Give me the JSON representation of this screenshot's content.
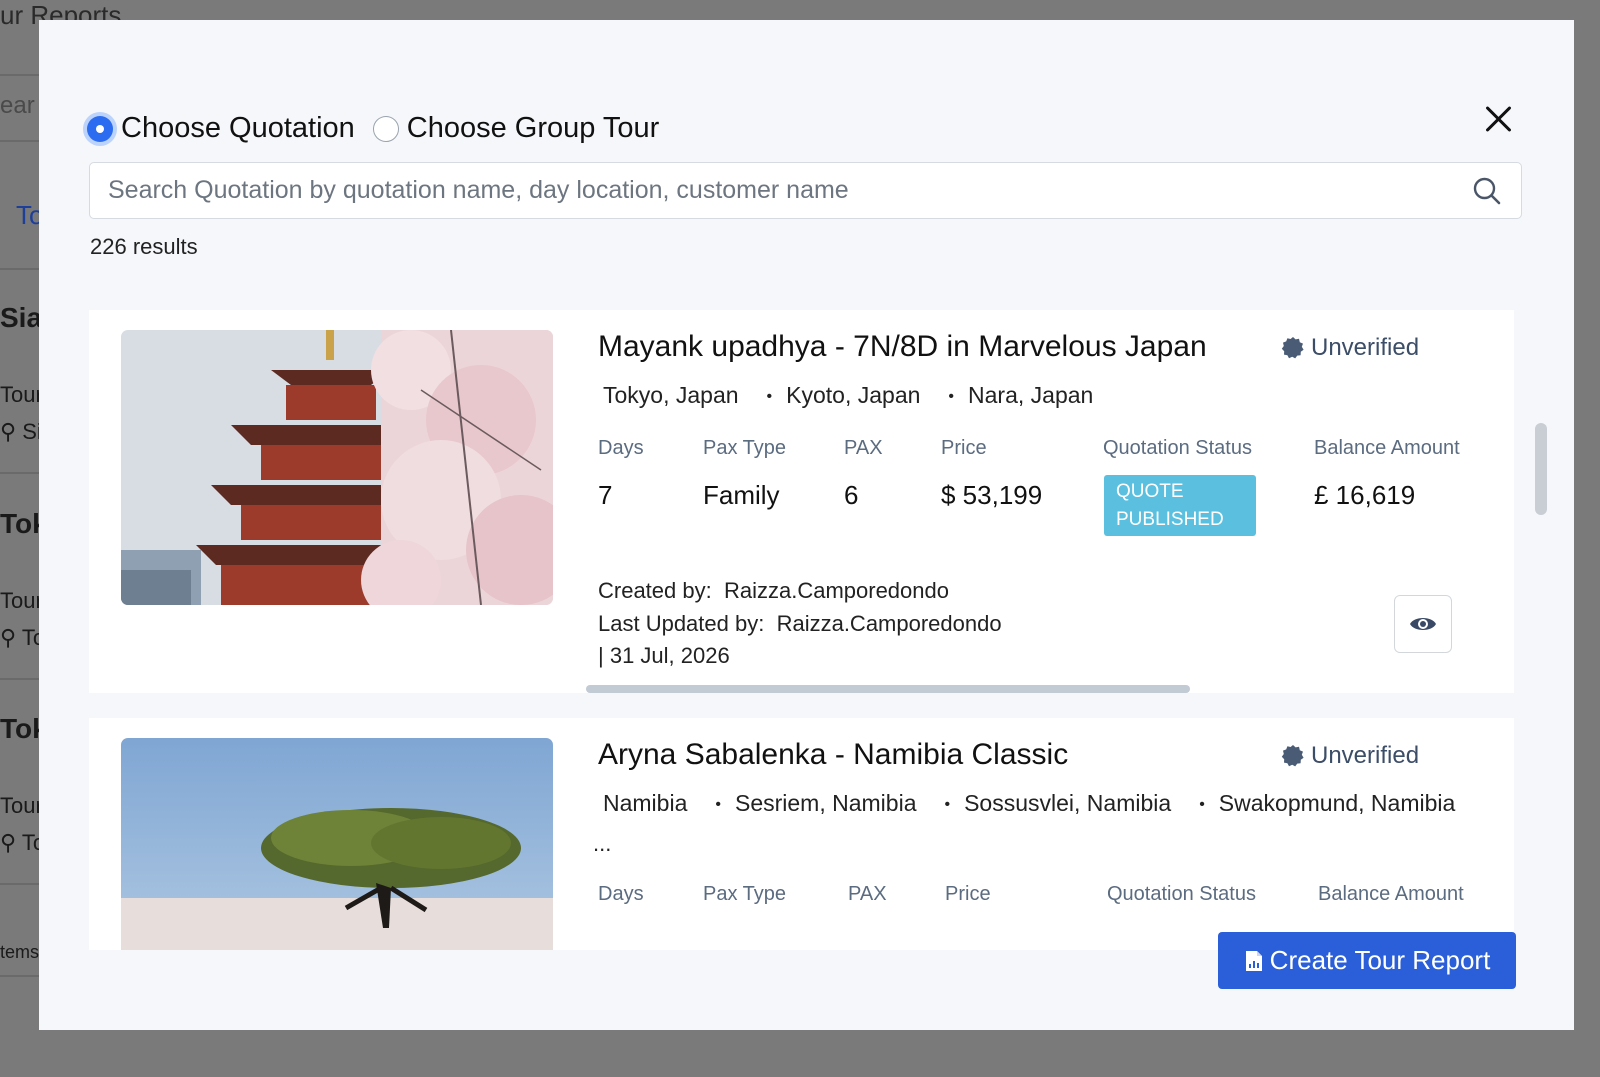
{
  "background": {
    "page_title": "ur Reports",
    "search_fragment": "ear",
    "tab_fragment": "To",
    "cards": [
      {
        "title": "Siar",
        "sub": "Tour",
        "loc": "Si"
      },
      {
        "title": "Tok",
        "sub": "Tour",
        "loc": "To"
      },
      {
        "title": "Tok",
        "sub": "Tour",
        "loc": "To"
      }
    ],
    "items_fragment": "tems"
  },
  "modal": {
    "radio_options": [
      {
        "label": "Choose Quotation",
        "checked": true
      },
      {
        "label": "Choose Group Tour",
        "checked": false
      }
    ],
    "search": {
      "placeholder": "Search Quotation by quotation name, day location, customer name"
    },
    "results_count": "226 results",
    "field_labels": {
      "days": "Days",
      "pax_type": "Pax Type",
      "pax": "PAX",
      "price": "Price",
      "status": "Quotation Status",
      "balance": "Balance Amount"
    },
    "quotations": [
      {
        "title": "Mayank upadhya - 7N/8D in Marvelous Japan",
        "badge": "Unverified",
        "locations": [
          "Tokyo, Japan",
          "Kyoto, Japan",
          "Nara, Japan"
        ],
        "days": "7",
        "pax_type": "Family",
        "pax": "6",
        "price": "$ 53,199",
        "status": "QUOTE PUBLISHED",
        "balance": "£ 16,619",
        "created_by_label": "Created by:",
        "created_by": "Raizza.Camporedondo",
        "updated_by_label": "Last Updated by:",
        "updated_by": "Raizza.Camporedondo",
        "updated_date": "| 31 Jul, 2026",
        "image": "japanese-pagoda-cherry-blossom"
      },
      {
        "title": "Aryna Sabalenka - Namibia Classic",
        "badge": "Unverified",
        "locations": [
          "Namibia",
          "Sesriem, Namibia",
          "Sossusvlei, Namibia",
          "Swakopmund, Namibia"
        ],
        "more": "...",
        "image": "acacia-tree-savanna"
      }
    ],
    "create_button": "Create Tour Report",
    "colors": {
      "primary": "#2b5fd9",
      "radio_checked": "#2b6cf0",
      "status_pill": "#5bc0e0",
      "badge": "#3c4d68"
    }
  }
}
